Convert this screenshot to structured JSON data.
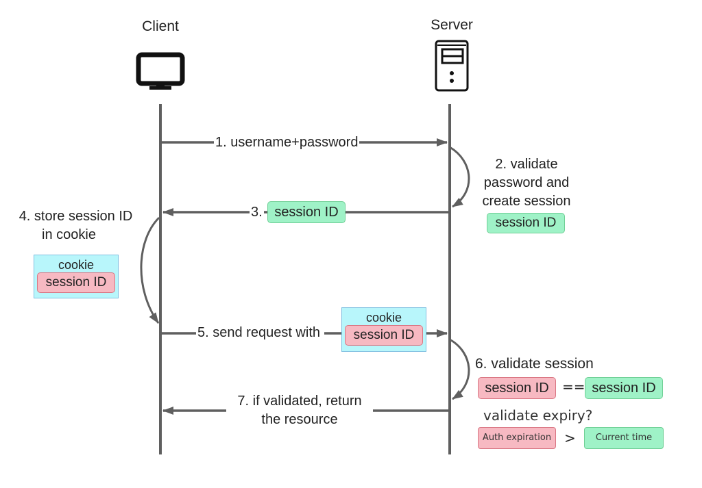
{
  "actors": {
    "client": {
      "label": "Client",
      "icon": "monitor-icon"
    },
    "server": {
      "label": "Server",
      "icon": "server-tower-icon"
    }
  },
  "steps": {
    "step1": {
      "label": "1. username+password",
      "direction": "client-to-server"
    },
    "step2": {
      "line1": "2. validate",
      "line2": "password and",
      "line3": "create session",
      "token": "session ID"
    },
    "step3": {
      "prefix": "3.",
      "token": "session ID",
      "direction": "server-to-client"
    },
    "step4": {
      "line1": "4. store session ID",
      "line2": "in cookie",
      "cookie_title": "cookie",
      "token": "session ID"
    },
    "step5": {
      "label": "5. send request with",
      "cookie_title": "cookie",
      "token": "session ID",
      "direction": "client-to-server"
    },
    "step6": {
      "label": "6. validate session",
      "left_token": "session ID",
      "operator": "==",
      "right_token": "session ID",
      "expiry_label": "validate expiry?",
      "expiry_left": "Auth expiration",
      "expiry_operator": ">",
      "expiry_right": "Current time"
    },
    "step7": {
      "line1": "7. if validated, return",
      "line2": "the resource",
      "direction": "server-to-client"
    }
  },
  "colors": {
    "line": "#5f5f5f",
    "token_green": "#9ff2c7",
    "token_red": "#f7b9c2",
    "cookie_blue": "#b8f6fb"
  }
}
